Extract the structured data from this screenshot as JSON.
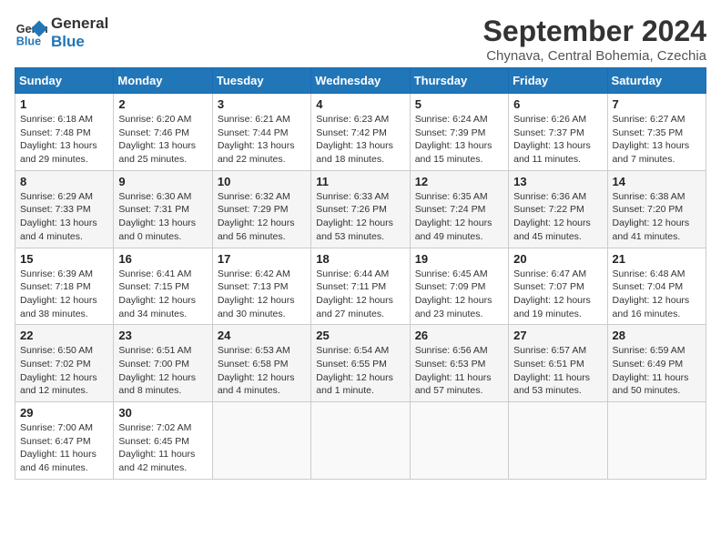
{
  "logo": {
    "line1": "General",
    "line2": "Blue"
  },
  "title": "September 2024",
  "location": "Chynava, Central Bohemia, Czechia",
  "weekdays": [
    "Sunday",
    "Monday",
    "Tuesday",
    "Wednesday",
    "Thursday",
    "Friday",
    "Saturday"
  ],
  "days": [
    null,
    null,
    null,
    {
      "num": "1",
      "sunrise": "Sunrise: 6:18 AM",
      "sunset": "Sunset: 7:48 PM",
      "daylight": "Daylight: 13 hours and 29 minutes."
    },
    {
      "num": "2",
      "sunrise": "Sunrise: 6:20 AM",
      "sunset": "Sunset: 7:46 PM",
      "daylight": "Daylight: 13 hours and 25 minutes."
    },
    {
      "num": "3",
      "sunrise": "Sunrise: 6:21 AM",
      "sunset": "Sunset: 7:44 PM",
      "daylight": "Daylight: 13 hours and 22 minutes."
    },
    {
      "num": "4",
      "sunrise": "Sunrise: 6:23 AM",
      "sunset": "Sunset: 7:42 PM",
      "daylight": "Daylight: 13 hours and 18 minutes."
    },
    {
      "num": "5",
      "sunrise": "Sunrise: 6:24 AM",
      "sunset": "Sunset: 7:39 PM",
      "daylight": "Daylight: 13 hours and 15 minutes."
    },
    {
      "num": "6",
      "sunrise": "Sunrise: 6:26 AM",
      "sunset": "Sunset: 7:37 PM",
      "daylight": "Daylight: 13 hours and 11 minutes."
    },
    {
      "num": "7",
      "sunrise": "Sunrise: 6:27 AM",
      "sunset": "Sunset: 7:35 PM",
      "daylight": "Daylight: 13 hours and 7 minutes."
    },
    {
      "num": "8",
      "sunrise": "Sunrise: 6:29 AM",
      "sunset": "Sunset: 7:33 PM",
      "daylight": "Daylight: 13 hours and 4 minutes."
    },
    {
      "num": "9",
      "sunrise": "Sunrise: 6:30 AM",
      "sunset": "Sunset: 7:31 PM",
      "daylight": "Daylight: 13 hours and 0 minutes."
    },
    {
      "num": "10",
      "sunrise": "Sunrise: 6:32 AM",
      "sunset": "Sunset: 7:29 PM",
      "daylight": "Daylight: 12 hours and 56 minutes."
    },
    {
      "num": "11",
      "sunrise": "Sunrise: 6:33 AM",
      "sunset": "Sunset: 7:26 PM",
      "daylight": "Daylight: 12 hours and 53 minutes."
    },
    {
      "num": "12",
      "sunrise": "Sunrise: 6:35 AM",
      "sunset": "Sunset: 7:24 PM",
      "daylight": "Daylight: 12 hours and 49 minutes."
    },
    {
      "num": "13",
      "sunrise": "Sunrise: 6:36 AM",
      "sunset": "Sunset: 7:22 PM",
      "daylight": "Daylight: 12 hours and 45 minutes."
    },
    {
      "num": "14",
      "sunrise": "Sunrise: 6:38 AM",
      "sunset": "Sunset: 7:20 PM",
      "daylight": "Daylight: 12 hours and 41 minutes."
    },
    {
      "num": "15",
      "sunrise": "Sunrise: 6:39 AM",
      "sunset": "Sunset: 7:18 PM",
      "daylight": "Daylight: 12 hours and 38 minutes."
    },
    {
      "num": "16",
      "sunrise": "Sunrise: 6:41 AM",
      "sunset": "Sunset: 7:15 PM",
      "daylight": "Daylight: 12 hours and 34 minutes."
    },
    {
      "num": "17",
      "sunrise": "Sunrise: 6:42 AM",
      "sunset": "Sunset: 7:13 PM",
      "daylight": "Daylight: 12 hours and 30 minutes."
    },
    {
      "num": "18",
      "sunrise": "Sunrise: 6:44 AM",
      "sunset": "Sunset: 7:11 PM",
      "daylight": "Daylight: 12 hours and 27 minutes."
    },
    {
      "num": "19",
      "sunrise": "Sunrise: 6:45 AM",
      "sunset": "Sunset: 7:09 PM",
      "daylight": "Daylight: 12 hours and 23 minutes."
    },
    {
      "num": "20",
      "sunrise": "Sunrise: 6:47 AM",
      "sunset": "Sunset: 7:07 PM",
      "daylight": "Daylight: 12 hours and 19 minutes."
    },
    {
      "num": "21",
      "sunrise": "Sunrise: 6:48 AM",
      "sunset": "Sunset: 7:04 PM",
      "daylight": "Daylight: 12 hours and 16 minutes."
    },
    {
      "num": "22",
      "sunrise": "Sunrise: 6:50 AM",
      "sunset": "Sunset: 7:02 PM",
      "daylight": "Daylight: 12 hours and 12 minutes."
    },
    {
      "num": "23",
      "sunrise": "Sunrise: 6:51 AM",
      "sunset": "Sunset: 7:00 PM",
      "daylight": "Daylight: 12 hours and 8 minutes."
    },
    {
      "num": "24",
      "sunrise": "Sunrise: 6:53 AM",
      "sunset": "Sunset: 6:58 PM",
      "daylight": "Daylight: 12 hours and 4 minutes."
    },
    {
      "num": "25",
      "sunrise": "Sunrise: 6:54 AM",
      "sunset": "Sunset: 6:55 PM",
      "daylight": "Daylight: 12 hours and 1 minute."
    },
    {
      "num": "26",
      "sunrise": "Sunrise: 6:56 AM",
      "sunset": "Sunset: 6:53 PM",
      "daylight": "Daylight: 11 hours and 57 minutes."
    },
    {
      "num": "27",
      "sunrise": "Sunrise: 6:57 AM",
      "sunset": "Sunset: 6:51 PM",
      "daylight": "Daylight: 11 hours and 53 minutes."
    },
    {
      "num": "28",
      "sunrise": "Sunrise: 6:59 AM",
      "sunset": "Sunset: 6:49 PM",
      "daylight": "Daylight: 11 hours and 50 minutes."
    },
    {
      "num": "29",
      "sunrise": "Sunrise: 7:00 AM",
      "sunset": "Sunset: 6:47 PM",
      "daylight": "Daylight: 11 hours and 46 minutes."
    },
    {
      "num": "30",
      "sunrise": "Sunrise: 7:02 AM",
      "sunset": "Sunset: 6:45 PM",
      "daylight": "Daylight: 11 hours and 42 minutes."
    }
  ]
}
